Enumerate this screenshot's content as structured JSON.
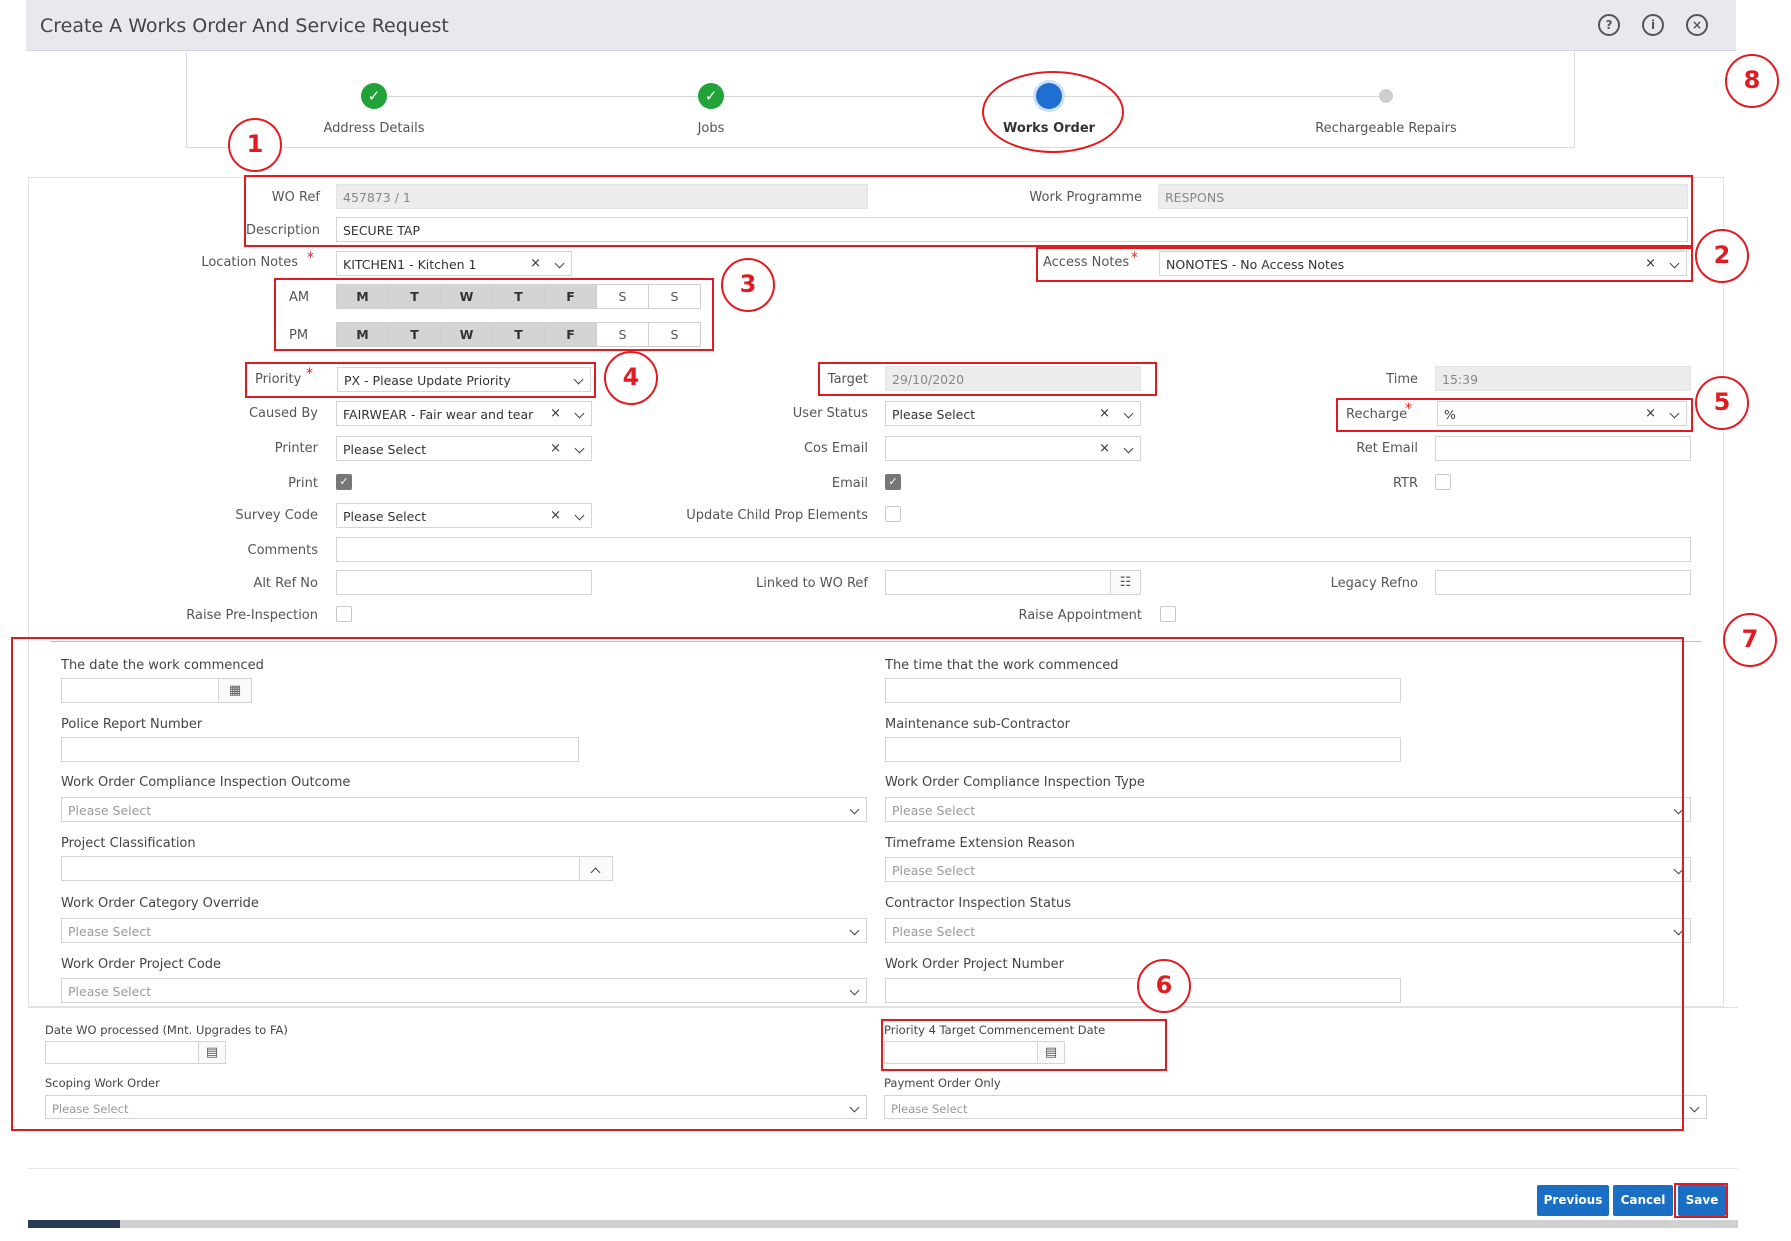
{
  "window": {
    "title": "Create A Works Order And Service Request",
    "icons": [
      "help-icon",
      "info-icon",
      "close-icon"
    ]
  },
  "wizard": {
    "steps": [
      {
        "label": "Address Details",
        "state": "done"
      },
      {
        "label": "Jobs",
        "state": "done"
      },
      {
        "label": "Works Order",
        "state": "current"
      },
      {
        "label": "Rechargeable Repairs",
        "state": "pending"
      }
    ]
  },
  "form": {
    "wo_ref_label": "WO Ref",
    "wo_ref_value": "457873 / 1",
    "work_programme_label": "Work Programme",
    "work_programme_value": "RESPONS",
    "description_label": "Description",
    "description_value": "SECURE TAP",
    "location_notes_label": "Location Notes",
    "location_notes_value": "KITCHEN1 - Kitchen 1",
    "access_notes_label": "Access Notes",
    "access_notes_value": "NONOTES - No Access Notes",
    "required_mark": "*",
    "clear_glyph": "×",
    "am_label": "AM",
    "pm_label": "PM",
    "days": [
      "M",
      "T",
      "W",
      "T",
      "F",
      "S",
      "S"
    ],
    "priority_label": "Priority",
    "priority_value": "PX - Please Update Priority",
    "target_label": "Target",
    "target_value": "29/10/2020",
    "time_label": "Time",
    "time_value": "15:39",
    "caused_by_label": "Caused By",
    "caused_by_value": "FAIRWEAR - Fair wear and tear",
    "user_status_label": "User Status",
    "user_status_value": "Please Select",
    "recharge_label": "Recharge",
    "recharge_value": "%",
    "printer_label": "Printer",
    "printer_value": "Please Select",
    "cos_email_label": "Cos Email",
    "ret_email_label": "Ret Email",
    "print_label": "Print",
    "email_label": "Email",
    "rtr_label": "RTR",
    "survey_code_label": "Survey Code",
    "survey_code_value": "Please Select",
    "update_child_label": "Update Child Prop Elements",
    "comments_label": "Comments",
    "alt_ref_label": "Alt Ref No",
    "linked_wo_label": "Linked to WO Ref",
    "legacy_refno_label": "Legacy Refno",
    "raise_pre_label": "Raise Pre-Inspection",
    "raise_appt_label": "Raise Appointment"
  },
  "extra": {
    "placeholder": "Please Select",
    "date_work_commenced": "The date the work commenced",
    "time_work_commenced": "The time that the work commenced",
    "police_report": "Police Report Number",
    "maintenance_sub": "Maintenance sub-Contractor",
    "compliance_outcome": "Work Order Compliance Inspection Outcome",
    "compliance_type": "Work Order Compliance Inspection Type",
    "project_classification": "Project Classification",
    "timeframe_reason": "Timeframe Extension Reason",
    "category_override": "Work Order Category Override",
    "contractor_status": "Contractor Inspection Status",
    "project_code": "Work Order Project Code",
    "project_number": "Work Order Project Number",
    "date_wo_processed": "Date WO processed (Mnt. Upgrades to FA)",
    "priority4_date": "Priority 4 Target Commencement Date",
    "scoping_wo": "Scoping Work Order",
    "payment_order": "Payment Order Only"
  },
  "buttons": {
    "previous": "Previous",
    "cancel": "Cancel",
    "save": "Save"
  },
  "annotations": [
    "1",
    "2",
    "3",
    "4",
    "5",
    "6",
    "7",
    "8"
  ],
  "colors": {
    "accent": "#1a6fc4",
    "success": "#22a33a",
    "annotation": "#e11b22"
  }
}
